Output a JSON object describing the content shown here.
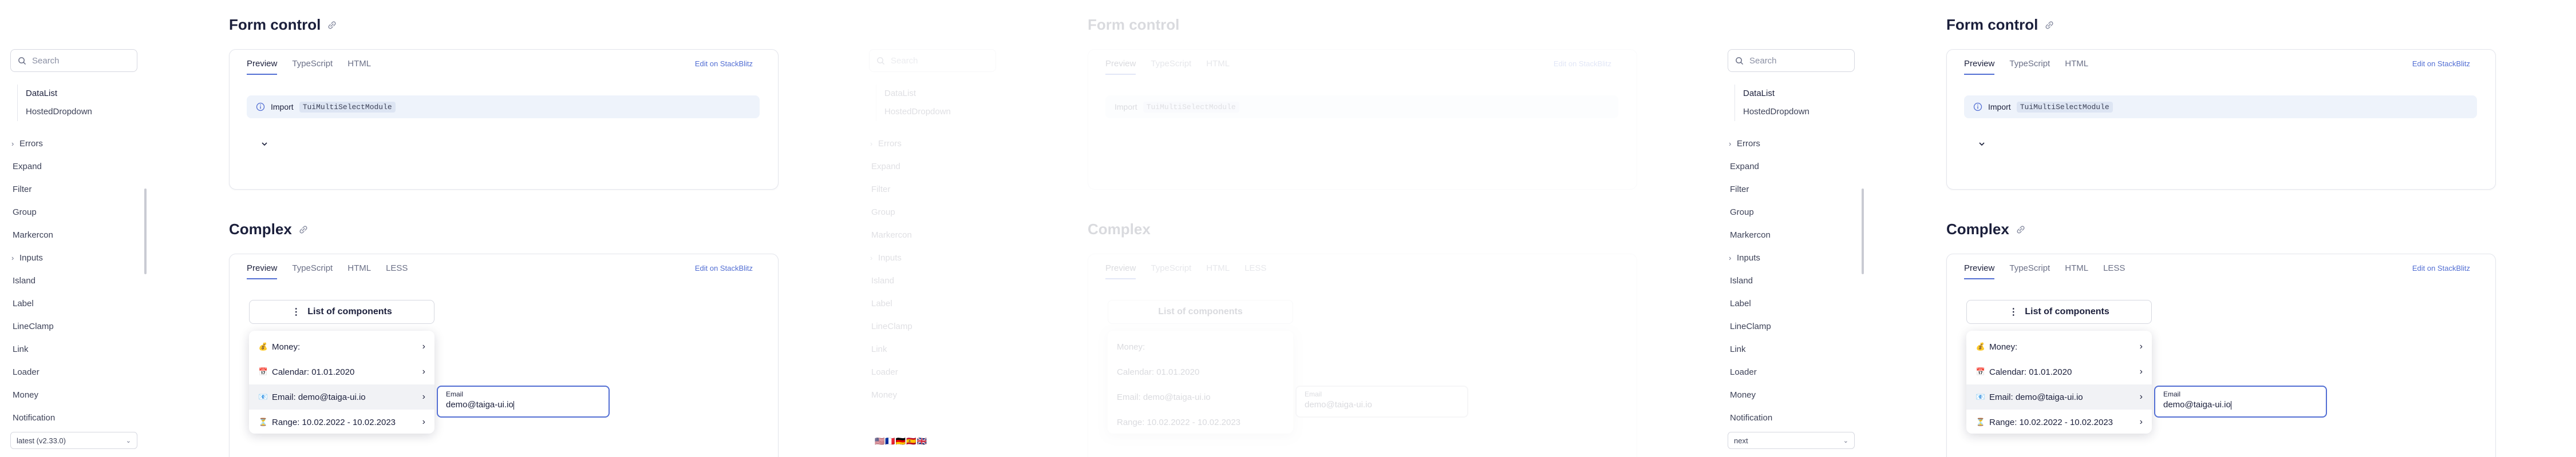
{
  "colors": {
    "accent": "#526ed3",
    "text": "#1b1f3b",
    "muted": "#6b7087",
    "notice_bg": "#eef3fb"
  },
  "sidebar": {
    "search_placeholder": "Search",
    "sub_items": [
      "DataList",
      "HostedDropdown"
    ],
    "items": [
      {
        "label": "Errors",
        "chevron": true
      },
      {
        "label": "Expand",
        "chevron": false
      },
      {
        "label": "Filter",
        "chevron": false
      },
      {
        "label": "Group",
        "chevron": false
      },
      {
        "label": "Markercon",
        "chevron": false
      },
      {
        "label": "Inputs",
        "chevron": true
      },
      {
        "label": "Island",
        "chevron": false
      },
      {
        "label": "Label",
        "chevron": false
      },
      {
        "label": "LineClamp",
        "chevron": false
      },
      {
        "label": "Link",
        "chevron": false
      },
      {
        "label": "Loader",
        "chevron": false
      },
      {
        "label": "Money",
        "chevron": false
      },
      {
        "label": "Notification",
        "chevron": false
      }
    ],
    "version_panel1": "latest (v2.33.0)",
    "version_panel4": "next"
  },
  "form_control": {
    "title": "Form control",
    "tabs": [
      "Preview",
      "TypeScript",
      "HTML"
    ],
    "edit_link": "Edit on StackBlitz",
    "notice_prefix": "Import",
    "notice_code": "TuiMultiSelectModule"
  },
  "complex": {
    "title": "Complex",
    "tabs": [
      "Preview",
      "TypeScript",
      "HTML",
      "LESS"
    ],
    "edit_link": "Edit on StackBlitz",
    "list_button": "List of components",
    "menu": [
      {
        "icon": "money-icon",
        "emoji": "💰",
        "label": "Money:"
      },
      {
        "icon": "calendar-icon",
        "emoji": "📅",
        "label": "Calendar: 01.01.2020"
      },
      {
        "icon": "email-icon",
        "emoji": "📧",
        "label": "Email: demo@taiga-ui.io"
      },
      {
        "icon": "hourglass-icon",
        "emoji": "⏳",
        "label": "Range: 10.02.2022 - 10.02.2023"
      }
    ],
    "email_label": "Email",
    "email_value": "demo@taiga-ui.io"
  },
  "strip_emoji": "🇺🇸🇫🇷🇩🇪🇪🇸🇬🇧"
}
